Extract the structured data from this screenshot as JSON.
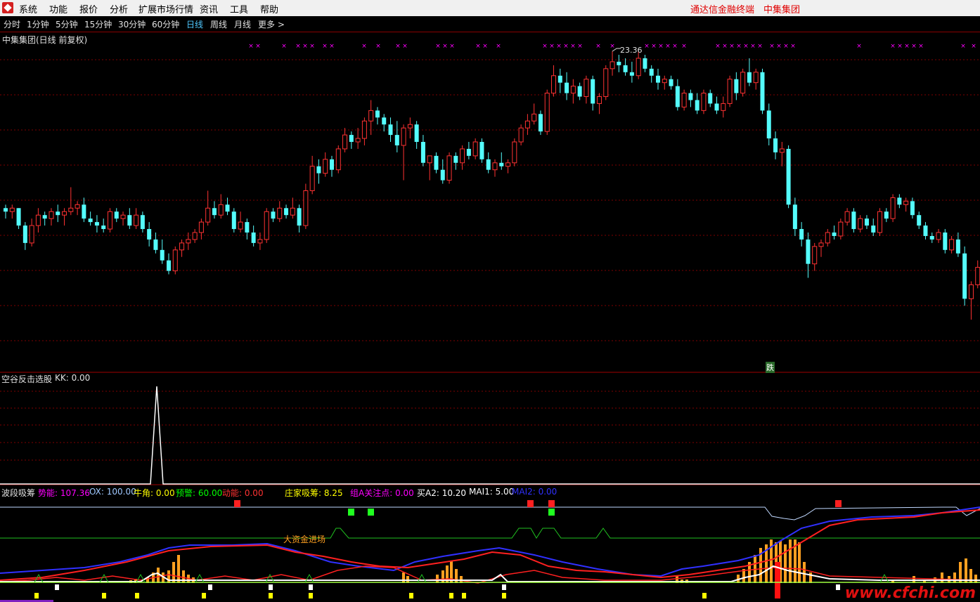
{
  "menu": {
    "items": [
      "系统",
      "功能",
      "报价",
      "分析",
      "扩展市场行情",
      "资讯",
      "工具",
      "帮助"
    ],
    "right_text": "通达信金融终端　中集集团"
  },
  "periods": {
    "items": [
      "分时",
      "1分钟",
      "5分钟",
      "15分钟",
      "30分钟",
      "60分钟",
      "日线",
      "周线",
      "月线",
      "更多 >"
    ],
    "active": "日线"
  },
  "main_chart": {
    "title": "中集集团(日线 前复权)",
    "high_label": "23.36",
    "fall_badge": "跌",
    "colors": {
      "up": "#ff3232",
      "down": "#54fcfc",
      "grid": "#800000",
      "marker": "#ff00ff"
    }
  },
  "panel2": {
    "title": "空谷反击选股",
    "kk": "KK: 0.00"
  },
  "panel3": {
    "title": "波段吸筹",
    "indicators": [
      {
        "text": "势能: 107.36",
        "color": "#ff00ff"
      },
      {
        "text": "OX: 100.00",
        "color": "#a0c8ff"
      },
      {
        "text": "牛角: 0.00",
        "color": "#ffff00"
      },
      {
        "text": "预警: 60.00",
        "color": "#00ff00"
      },
      {
        "text": "动能: 0.00",
        "color": "#ff3232"
      },
      {
        "text": "庄家吸筹: 8.25",
        "color": "#ffff00"
      },
      {
        "text": "组A关注点: 0.00",
        "color": "#ff00ff"
      },
      {
        "text": "买A2: 10.20",
        "color": "#ffffff"
      },
      {
        "text": "MAI1: 5.00",
        "color": "#ffffff"
      },
      {
        "text": "MAI2: 0.00",
        "color": "#3030ff"
      }
    ],
    "annotation": "大资金进场"
  },
  "watermark": "www.cfchi.com",
  "chart_data": {
    "type": "candlestick",
    "title": "中集集团(日线 前复权)",
    "y_max_label": 23.36,
    "candles": [
      [
        18.9,
        19.0,
        18.6,
        18.8
      ],
      [
        18.8,
        19.0,
        18.6,
        18.9
      ],
      [
        18.9,
        18.9,
        18.3,
        18.4
      ],
      [
        18.4,
        18.5,
        17.7,
        17.9
      ],
      [
        17.9,
        18.6,
        17.8,
        18.4
      ],
      [
        18.4,
        18.9,
        18.2,
        18.7
      ],
      [
        18.7,
        18.8,
        18.4,
        18.6
      ],
      [
        18.6,
        18.9,
        18.4,
        18.8
      ],
      [
        18.8,
        19.0,
        18.5,
        18.7
      ],
      [
        18.7,
        18.9,
        18.4,
        18.8
      ],
      [
        18.8,
        19.5,
        18.7,
        18.9
      ],
      [
        18.9,
        19.1,
        18.7,
        19.0
      ],
      [
        19.0,
        19.2,
        18.5,
        18.6
      ],
      [
        18.6,
        18.8,
        18.4,
        18.5
      ],
      [
        18.5,
        18.7,
        18.2,
        18.4
      ],
      [
        18.4,
        18.6,
        18.2,
        18.3
      ],
      [
        18.3,
        18.9,
        18.2,
        18.8
      ],
      [
        18.8,
        18.9,
        18.5,
        18.6
      ],
      [
        18.6,
        18.8,
        18.4,
        18.7
      ],
      [
        18.7,
        18.9,
        18.3,
        18.4
      ],
      [
        18.4,
        18.9,
        18.3,
        18.7
      ],
      [
        18.7,
        18.8,
        18.2,
        18.3
      ],
      [
        18.3,
        18.5,
        17.8,
        18.0
      ],
      [
        18.0,
        18.2,
        17.6,
        17.7
      ],
      [
        17.7,
        18.0,
        17.3,
        17.4
      ],
      [
        17.4,
        17.6,
        17.0,
        17.1
      ],
      [
        17.1,
        17.8,
        17.0,
        17.7
      ],
      [
        17.7,
        18.0,
        17.5,
        17.9
      ],
      [
        17.9,
        18.2,
        17.7,
        18.0
      ],
      [
        18.0,
        18.3,
        17.9,
        18.2
      ],
      [
        18.2,
        18.6,
        18.0,
        18.5
      ],
      [
        18.5,
        19.4,
        18.4,
        18.9
      ],
      [
        18.9,
        19.1,
        18.6,
        18.7
      ],
      [
        18.7,
        19.3,
        18.6,
        19.0
      ],
      [
        19.0,
        19.2,
        18.7,
        18.8
      ],
      [
        18.8,
        18.9,
        18.2,
        18.3
      ],
      [
        18.3,
        18.8,
        18.2,
        18.5
      ],
      [
        18.5,
        18.6,
        18.0,
        18.2
      ],
      [
        18.2,
        18.4,
        17.8,
        17.9
      ],
      [
        17.9,
        18.2,
        17.7,
        18.0
      ],
      [
        18.0,
        18.9,
        17.9,
        18.8
      ],
      [
        18.8,
        18.9,
        18.5,
        18.6
      ],
      [
        18.6,
        19.1,
        18.5,
        18.9
      ],
      [
        18.9,
        19.0,
        18.6,
        18.7
      ],
      [
        18.7,
        19.2,
        18.6,
        18.9
      ],
      [
        18.9,
        19.0,
        18.2,
        18.4
      ],
      [
        18.4,
        19.6,
        18.3,
        19.4
      ],
      [
        19.4,
        20.4,
        19.3,
        20.1
      ],
      [
        20.1,
        20.3,
        19.6,
        19.9
      ],
      [
        19.9,
        20.5,
        19.8,
        20.3
      ],
      [
        20.3,
        20.4,
        19.8,
        20.0
      ],
      [
        20.0,
        20.7,
        19.9,
        20.6
      ],
      [
        20.6,
        21.2,
        20.5,
        21.0
      ],
      [
        21.0,
        21.1,
        20.6,
        20.8
      ],
      [
        20.8,
        21.2,
        20.6,
        20.9
      ],
      [
        20.9,
        21.5,
        20.7,
        21.4
      ],
      [
        21.4,
        22.0,
        21.0,
        21.7
      ],
      [
        21.7,
        21.8,
        21.3,
        21.5
      ],
      [
        21.5,
        21.6,
        21.1,
        21.3
      ],
      [
        21.3,
        21.5,
        20.8,
        21.0
      ],
      [
        21.0,
        21.4,
        20.5,
        20.7
      ],
      [
        20.7,
        21.3,
        19.7,
        21.2
      ],
      [
        21.2,
        21.5,
        20.9,
        21.3
      ],
      [
        21.3,
        21.4,
        20.6,
        20.8
      ],
      [
        20.8,
        21.0,
        20.1,
        20.2
      ],
      [
        20.2,
        20.4,
        19.7,
        20.4
      ],
      [
        20.4,
        20.5,
        19.9,
        20.0
      ],
      [
        20.0,
        20.3,
        19.6,
        19.7
      ],
      [
        19.7,
        20.5,
        19.6,
        20.4
      ],
      [
        20.4,
        20.5,
        20.0,
        20.2
      ],
      [
        20.2,
        20.7,
        20.0,
        20.6
      ],
      [
        20.6,
        20.8,
        20.3,
        20.4
      ],
      [
        20.4,
        20.9,
        20.3,
        20.8
      ],
      [
        20.8,
        20.9,
        20.2,
        20.3
      ],
      [
        20.3,
        20.5,
        19.9,
        20.0
      ],
      [
        20.0,
        20.3,
        19.8,
        20.2
      ],
      [
        20.2,
        20.5,
        20.0,
        20.1
      ],
      [
        20.1,
        20.3,
        19.9,
        20.2
      ],
      [
        20.2,
        20.9,
        20.1,
        20.8
      ],
      [
        20.8,
        21.3,
        20.7,
        21.2
      ],
      [
        21.2,
        21.6,
        21.0,
        21.4
      ],
      [
        21.4,
        21.9,
        21.3,
        21.6
      ],
      [
        21.6,
        21.7,
        21.0,
        21.1
      ],
      [
        21.1,
        22.3,
        21.0,
        22.2
      ],
      [
        22.2,
        23.0,
        22.1,
        22.7
      ],
      [
        22.7,
        22.9,
        22.2,
        22.5
      ],
      [
        22.5,
        22.8,
        22.0,
        22.2
      ],
      [
        22.2,
        22.6,
        21.9,
        22.4
      ],
      [
        22.4,
        22.5,
        22.0,
        22.1
      ],
      [
        22.1,
        22.7,
        21.9,
        22.6
      ],
      [
        22.6,
        22.7,
        21.7,
        21.9
      ],
      [
        21.9,
        22.2,
        21.6,
        22.1
      ],
      [
        22.1,
        23.0,
        22.0,
        22.9
      ],
      [
        22.9,
        23.4,
        22.7,
        23.1
      ],
      [
        23.1,
        23.3,
        22.8,
        23.0
      ],
      [
        23.0,
        23.2,
        22.7,
        22.8
      ],
      [
        22.8,
        23.1,
        22.5,
        22.7
      ],
      [
        22.7,
        23.4,
        22.6,
        23.2
      ],
      [
        23.2,
        23.3,
        22.8,
        22.9
      ],
      [
        22.9,
        23.0,
        22.5,
        22.7
      ],
      [
        22.7,
        22.9,
        22.3,
        22.5
      ],
      [
        22.5,
        22.7,
        22.3,
        22.6
      ],
      [
        22.6,
        22.7,
        22.3,
        22.4
      ],
      [
        22.4,
        22.6,
        21.7,
        21.8
      ],
      [
        21.8,
        22.3,
        21.7,
        22.2
      ],
      [
        22.2,
        22.3,
        21.8,
        22.0
      ],
      [
        22.0,
        22.2,
        21.6,
        21.7
      ],
      [
        21.7,
        22.3,
        21.6,
        22.2
      ],
      [
        22.2,
        22.3,
        21.8,
        21.9
      ],
      [
        21.9,
        22.1,
        21.6,
        21.7
      ],
      [
        21.7,
        22.1,
        21.5,
        21.9
      ],
      [
        21.9,
        22.7,
        21.8,
        22.6
      ],
      [
        22.6,
        22.8,
        22.0,
        22.2
      ],
      [
        22.2,
        22.9,
        22.1,
        22.8
      ],
      [
        22.8,
        23.2,
        22.4,
        22.5
      ],
      [
        22.5,
        22.9,
        22.3,
        22.8
      ],
      [
        22.8,
        22.9,
        21.6,
        21.7
      ],
      [
        21.7,
        21.9,
        20.7,
        20.9
      ],
      [
        20.9,
        21.1,
        20.3,
        20.5
      ],
      [
        20.5,
        20.8,
        20.1,
        20.6
      ],
      [
        20.6,
        20.7,
        18.9,
        19.0
      ],
      [
        19.0,
        19.2,
        18.1,
        18.3
      ],
      [
        18.3,
        18.5,
        17.8,
        18.0
      ],
      [
        18.0,
        18.2,
        16.9,
        17.3
      ],
      [
        17.3,
        17.9,
        17.1,
        17.8
      ],
      [
        17.8,
        18.0,
        17.5,
        17.9
      ],
      [
        17.9,
        18.3,
        17.8,
        18.2
      ],
      [
        18.2,
        18.4,
        18.0,
        18.1
      ],
      [
        18.1,
        18.6,
        18.0,
        18.5
      ],
      [
        18.5,
        18.9,
        18.4,
        18.8
      ],
      [
        18.8,
        18.9,
        18.2,
        18.3
      ],
      [
        18.3,
        18.7,
        18.2,
        18.6
      ],
      [
        18.6,
        18.7,
        18.3,
        18.4
      ],
      [
        18.4,
        18.6,
        18.1,
        18.2
      ],
      [
        18.2,
        18.9,
        18.1,
        18.8
      ],
      [
        18.8,
        18.9,
        18.5,
        18.6
      ],
      [
        18.6,
        19.3,
        18.5,
        19.2
      ],
      [
        19.2,
        19.3,
        18.9,
        19.0
      ],
      [
        19.0,
        19.2,
        18.8,
        19.1
      ],
      [
        19.1,
        19.2,
        18.6,
        18.7
      ],
      [
        18.7,
        18.8,
        18.3,
        18.4
      ],
      [
        18.4,
        18.5,
        18.0,
        18.1
      ],
      [
        18.1,
        18.2,
        17.9,
        18.0
      ],
      [
        18.0,
        18.3,
        17.9,
        18.2
      ],
      [
        18.2,
        18.3,
        17.6,
        17.7
      ],
      [
        17.7,
        18.1,
        17.6,
        18.0
      ],
      [
        18.0,
        18.2,
        17.5,
        17.6
      ],
      [
        17.6,
        17.8,
        16.1,
        16.3
      ],
      [
        16.3,
        16.8,
        15.7,
        16.7
      ],
      [
        16.7,
        17.4,
        16.6,
        17.2
      ]
    ]
  }
}
